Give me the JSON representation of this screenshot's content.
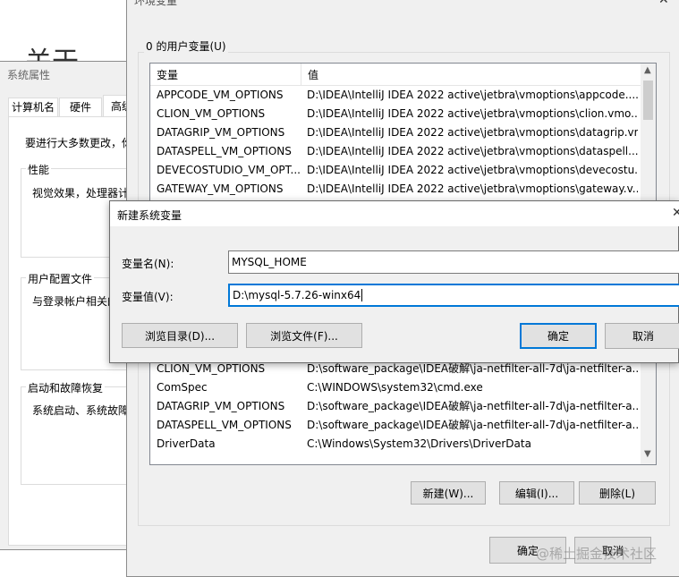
{
  "bg_window": {
    "title_fragment": "关于"
  },
  "system_properties": {
    "title": "系统属性",
    "tabs": [
      "计算机名",
      "硬件",
      "高级"
    ],
    "admin_note": "要进行大多数更改，你",
    "performance": {
      "label": "性能",
      "desc": "视觉效果，处理器计"
    },
    "user_profiles": {
      "label": "用户配置文件",
      "desc": "与登录帐户相关的"
    },
    "startup": {
      "label": "启动和故障恢复",
      "desc": "系统启动、系统故障"
    }
  },
  "env_dialog": {
    "title": "环境变量",
    "user_vars_label": "0 的用户变量(U)",
    "col_var": "变量",
    "col_val": "值",
    "user_rows": [
      {
        "name": "APPCODE_VM_OPTIONS",
        "value": "D:\\IDEA\\IntelliJ IDEA 2022 active\\jetbra\\vmoptions\\appcode...."
      },
      {
        "name": "CLION_VM_OPTIONS",
        "value": "D:\\IDEA\\IntelliJ IDEA 2022 active\\jetbra\\vmoptions\\clion.vmo..."
      },
      {
        "name": "DATAGRIP_VM_OPTIONS",
        "value": "D:\\IDEA\\IntelliJ IDEA 2022 active\\jetbra\\vmoptions\\datagrip.vm..."
      },
      {
        "name": "DATASPELL_VM_OPTIONS",
        "value": "D:\\IDEA\\IntelliJ IDEA 2022 active\\jetbra\\vmoptions\\dataspell...."
      },
      {
        "name": "DEVECOSTUDIO_VM_OPT...",
        "value": "D:\\IDEA\\IntelliJ IDEA 2022 active\\jetbra\\vmoptions\\devecostu..."
      },
      {
        "name": "GATEWAY_VM_OPTIONS",
        "value": "D:\\IDEA\\IntelliJ IDEA 2022 active\\jetbra\\vmoptions\\gateway.v..."
      }
    ],
    "system_rows": [
      {
        "name": "CLION_VM_OPTIONS",
        "value": "D:\\software_package\\IDEA破解\\ja-netfilter-all-7d\\ja-netfilter-a..."
      },
      {
        "name": "ComSpec",
        "value": "C:\\WINDOWS\\system32\\cmd.exe"
      },
      {
        "name": "DATAGRIP_VM_OPTIONS",
        "value": "D:\\software_package\\IDEA破解\\ja-netfilter-all-7d\\ja-netfilter-a..."
      },
      {
        "name": "DATASPELL_VM_OPTIONS",
        "value": "D:\\software_package\\IDEA破解\\ja-netfilter-all-7d\\ja-netfilter-a..."
      },
      {
        "name": "DriverData",
        "value": "C:\\Windows\\System32\\Drivers\\DriverData"
      }
    ],
    "buttons": {
      "new": "新建(W)...",
      "edit": "编辑(I)...",
      "delete": "删除(L)",
      "ok": "确定",
      "cancel": "取消"
    },
    "watermark": "@稀土掘金技术社区"
  },
  "new_var_dialog": {
    "title": "新建系统变量",
    "name_label": "变量名(N):",
    "name_value": "MYSQL_HOME",
    "value_label": "变量值(V):",
    "value_value": "D:\\mysql-5.7.26-winx64",
    "browse_dir": "浏览目录(D)...",
    "browse_file": "浏览文件(F)...",
    "ok": "确定",
    "cancel": "取消"
  }
}
